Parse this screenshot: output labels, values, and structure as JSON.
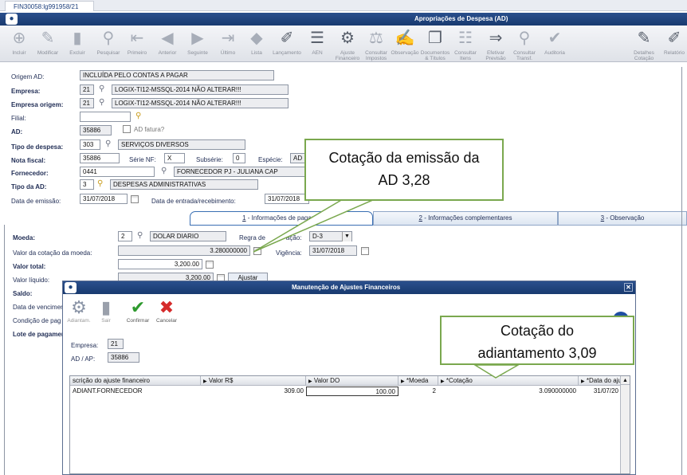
{
  "tab": {
    "label": "FIN30058:lg991958/21"
  },
  "window": {
    "title": "Apropriações de Despesa (AD)"
  },
  "toolbar": {
    "items": [
      {
        "label": "Incluir",
        "icon": "include-icon"
      },
      {
        "label": "Modificar",
        "icon": "modify-icon"
      },
      {
        "label": "Excluir",
        "icon": "delete-icon"
      },
      {
        "label": "Pesquisar",
        "icon": "search-icon"
      },
      {
        "label": "Primeiro",
        "icon": "first-icon"
      },
      {
        "label": "Anterior",
        "icon": "previous-icon"
      },
      {
        "label": "Seguinte",
        "icon": "next-icon"
      },
      {
        "label": "Último",
        "icon": "last-icon"
      },
      {
        "label": "Lista",
        "icon": "list-icon"
      },
      {
        "label": "Lançamento",
        "icon": "entry-icon"
      },
      {
        "label": "AEN",
        "icon": "aen-icon"
      },
      {
        "label": "Ajuste Financeiro",
        "icon": "financial-adjust-icon"
      },
      {
        "label": "Consultar Impostos",
        "icon": "taxes-icon"
      },
      {
        "label": "Observação",
        "icon": "note-icon"
      },
      {
        "label": "Documentos & Títulos",
        "icon": "documents-icon"
      },
      {
        "label": "Consultar Itens",
        "icon": "items-icon"
      },
      {
        "label": "Efetivar Previsão",
        "icon": "forecast-icon"
      },
      {
        "label": "Consultar Transf.",
        "icon": "transfer-icon"
      },
      {
        "label": "Auditoria",
        "icon": "audit-icon"
      },
      {
        "label": "Detalhes Cotação",
        "icon": "quote-details-icon"
      },
      {
        "label": "Relatório",
        "icon": "report-icon"
      }
    ]
  },
  "form": {
    "origem_ad": {
      "label": "Origem AD:",
      "value": "INCLUÍDA PELO CONTAS A PAGAR"
    },
    "empresa": {
      "label": "Empresa:",
      "code": "21",
      "name": "LOGIX-TI12-MSSQL-2014 NÃO ALTERAR!!!"
    },
    "empresa_origem": {
      "label": "Empresa origem:",
      "code": "21",
      "name": "LOGIX-TI12-MSSQL-2014 NÃO ALTERAR!!!"
    },
    "filial": {
      "label": "Filial:",
      "value": ""
    },
    "ad": {
      "label": "AD:",
      "value": "35886",
      "fatura_label": "AD fatura?"
    },
    "tipo_despesa": {
      "label": "Tipo de despesa:",
      "code": "303",
      "name": "SERVIÇOS DIVERSOS"
    },
    "nota_fiscal": {
      "label": "Nota fiscal:",
      "value": "35886",
      "serie_label": "Série NF:",
      "serie": "X",
      "subserie_label": "Subsérie:",
      "subserie": "0",
      "especie_label": "Espécie:",
      "especie": "AD"
    },
    "fornecedor": {
      "label": "Fornecedor:",
      "code": "0441",
      "name": "FORNECEDOR PJ - JULIANA CAP"
    },
    "tipo_ad": {
      "label": "Tipo da AD:",
      "code": "3",
      "name": "DESPESAS ADMINISTRATIVAS"
    },
    "data_emissao": {
      "label": "Data de emissão:",
      "value": "31/07/2018"
    },
    "data_entrada": {
      "label": "Data de entrada/recebimento:",
      "value": "31/07/2018"
    }
  },
  "folders": [
    {
      "num": "1",
      "label": " - Informações de pagame"
    },
    {
      "num": "2",
      "label": " - Informações complementares"
    },
    {
      "num": "3",
      "label": " - Observação"
    }
  ],
  "payment": {
    "moeda": {
      "label": "Moeda:",
      "code": "2",
      "name": "DOLAR DIARIO"
    },
    "regra_label": "Regra de",
    "regra_label2": "ação:",
    "regra_value": "D-3",
    "cotacao": {
      "label": "Valor da cotação da moeda:",
      "value": "3.280000000"
    },
    "vigencia": {
      "label": "Vigência:",
      "value": "31/07/2018"
    },
    "valor_total": {
      "label": "Valor total:",
      "value": "3,200.00"
    },
    "valor_liquido": {
      "label": "Valor líquido:",
      "value": "3,200.00",
      "button": "Ajustar"
    },
    "saldo_label": "Saldo:",
    "data_venc_label": "Data de vencimen",
    "condicao_label": "Condição de pag",
    "lote_label": "Lote de pagamen"
  },
  "callouts": {
    "emissao": {
      "line1": "Cotação da emissão da",
      "line2": "AD 3,28"
    },
    "adiantamento": {
      "line1": "Cotação do",
      "line2": "adiantamento 3,09"
    }
  },
  "dialog": {
    "title": "Manutenção de Ajustes Financeiros",
    "tools": [
      {
        "label": "Adiantam.",
        "icon": "advance-icon"
      },
      {
        "label": "Sair",
        "icon": "exit-icon"
      },
      {
        "label": "Confirmar",
        "icon": "confirm-icon"
      },
      {
        "label": "Cancelar",
        "icon": "cancel-icon"
      }
    ],
    "help": "?",
    "empresa": {
      "label": "Empresa:",
      "value": "21"
    },
    "ad_ap": {
      "label": "AD / AP:",
      "value": "35886"
    },
    "table": {
      "columns": [
        "scrição do ajuste financeiro",
        "Valor R$",
        "Valor DO",
        "*Moeda",
        "*Cotação",
        "*Data do aju"
      ],
      "rows": [
        [
          "ADIANT.FORNECEDOR",
          "309.00",
          "100.00",
          "2",
          "3.090000000",
          "31/07/20"
        ]
      ]
    }
  }
}
